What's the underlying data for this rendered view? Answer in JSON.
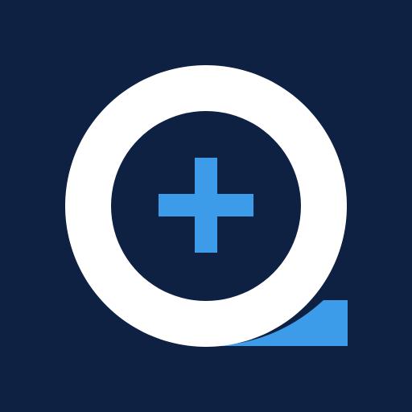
{
  "icon": {
    "name": "zoom-in-plus-logo",
    "colors": {
      "background": "#0E2143",
      "ring": "#FFFFFF",
      "accent": "#3D9CEA"
    }
  }
}
